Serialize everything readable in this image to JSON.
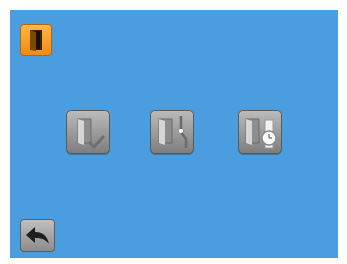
{
  "screen": {
    "background": "#4a9ee0"
  },
  "header": {
    "icon": "door-icon",
    "accent": "#f08a12"
  },
  "options": [
    {
      "name": "door-check-option",
      "icon": "door-check-icon"
    },
    {
      "name": "door-time-option",
      "icon": "door-time-icon"
    },
    {
      "name": "door-watch-option",
      "icon": "door-watch-icon"
    }
  ],
  "footer": {
    "back_icon": "back-arrow-icon"
  }
}
